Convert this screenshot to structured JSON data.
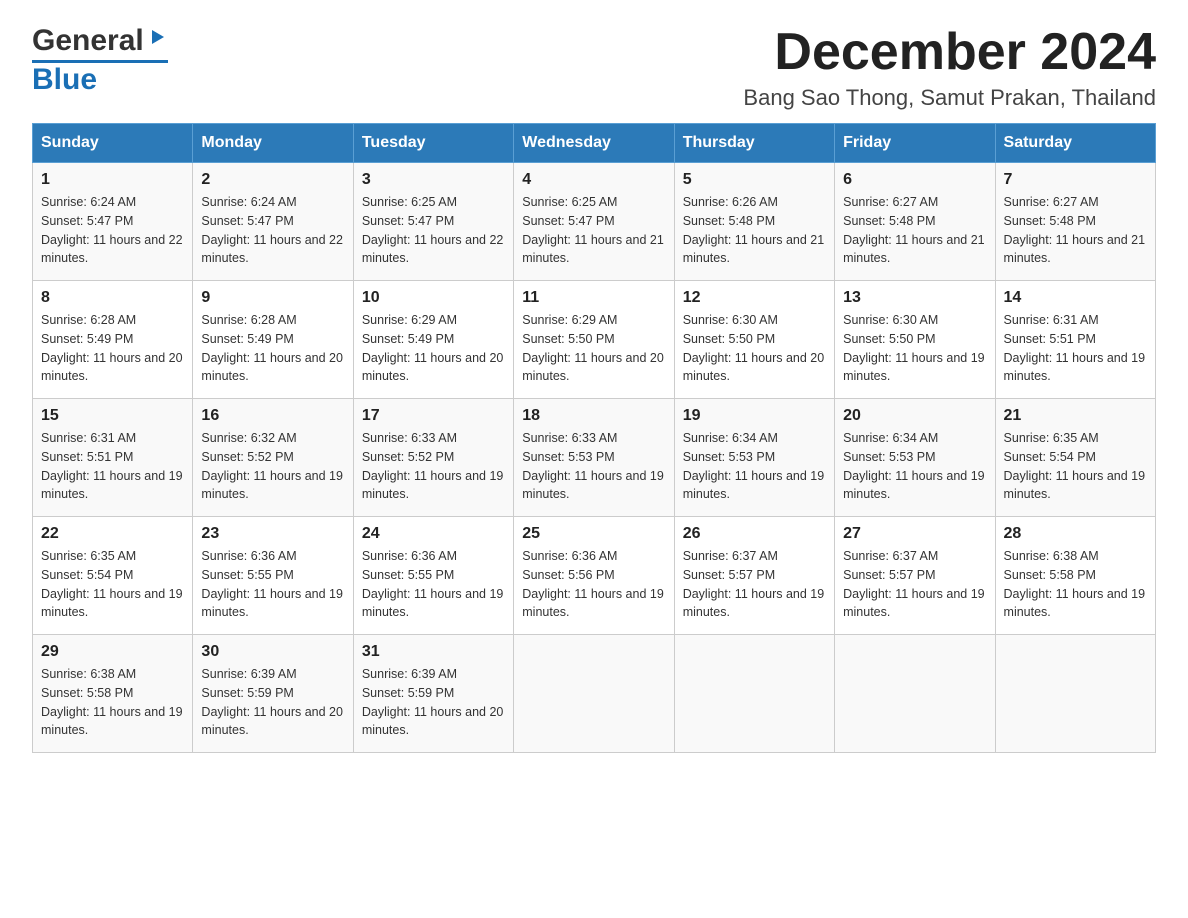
{
  "header": {
    "logo_general": "General",
    "logo_blue": "Blue",
    "month_title": "December 2024",
    "location": "Bang Sao Thong, Samut Prakan, Thailand"
  },
  "weekdays": [
    "Sunday",
    "Monday",
    "Tuesday",
    "Wednesday",
    "Thursday",
    "Friday",
    "Saturday"
  ],
  "weeks": [
    [
      {
        "day": "1",
        "sunrise": "6:24 AM",
        "sunset": "5:47 PM",
        "daylight": "11 hours and 22 minutes."
      },
      {
        "day": "2",
        "sunrise": "6:24 AM",
        "sunset": "5:47 PM",
        "daylight": "11 hours and 22 minutes."
      },
      {
        "day": "3",
        "sunrise": "6:25 AM",
        "sunset": "5:47 PM",
        "daylight": "11 hours and 22 minutes."
      },
      {
        "day": "4",
        "sunrise": "6:25 AM",
        "sunset": "5:47 PM",
        "daylight": "11 hours and 21 minutes."
      },
      {
        "day": "5",
        "sunrise": "6:26 AM",
        "sunset": "5:48 PM",
        "daylight": "11 hours and 21 minutes."
      },
      {
        "day": "6",
        "sunrise": "6:27 AM",
        "sunset": "5:48 PM",
        "daylight": "11 hours and 21 minutes."
      },
      {
        "day": "7",
        "sunrise": "6:27 AM",
        "sunset": "5:48 PM",
        "daylight": "11 hours and 21 minutes."
      }
    ],
    [
      {
        "day": "8",
        "sunrise": "6:28 AM",
        "sunset": "5:49 PM",
        "daylight": "11 hours and 20 minutes."
      },
      {
        "day": "9",
        "sunrise": "6:28 AM",
        "sunset": "5:49 PM",
        "daylight": "11 hours and 20 minutes."
      },
      {
        "day": "10",
        "sunrise": "6:29 AM",
        "sunset": "5:49 PM",
        "daylight": "11 hours and 20 minutes."
      },
      {
        "day": "11",
        "sunrise": "6:29 AM",
        "sunset": "5:50 PM",
        "daylight": "11 hours and 20 minutes."
      },
      {
        "day": "12",
        "sunrise": "6:30 AM",
        "sunset": "5:50 PM",
        "daylight": "11 hours and 20 minutes."
      },
      {
        "day": "13",
        "sunrise": "6:30 AM",
        "sunset": "5:50 PM",
        "daylight": "11 hours and 19 minutes."
      },
      {
        "day": "14",
        "sunrise": "6:31 AM",
        "sunset": "5:51 PM",
        "daylight": "11 hours and 19 minutes."
      }
    ],
    [
      {
        "day": "15",
        "sunrise": "6:31 AM",
        "sunset": "5:51 PM",
        "daylight": "11 hours and 19 minutes."
      },
      {
        "day": "16",
        "sunrise": "6:32 AM",
        "sunset": "5:52 PM",
        "daylight": "11 hours and 19 minutes."
      },
      {
        "day": "17",
        "sunrise": "6:33 AM",
        "sunset": "5:52 PM",
        "daylight": "11 hours and 19 minutes."
      },
      {
        "day": "18",
        "sunrise": "6:33 AM",
        "sunset": "5:53 PM",
        "daylight": "11 hours and 19 minutes."
      },
      {
        "day": "19",
        "sunrise": "6:34 AM",
        "sunset": "5:53 PM",
        "daylight": "11 hours and 19 minutes."
      },
      {
        "day": "20",
        "sunrise": "6:34 AM",
        "sunset": "5:53 PM",
        "daylight": "11 hours and 19 minutes."
      },
      {
        "day": "21",
        "sunrise": "6:35 AM",
        "sunset": "5:54 PM",
        "daylight": "11 hours and 19 minutes."
      }
    ],
    [
      {
        "day": "22",
        "sunrise": "6:35 AM",
        "sunset": "5:54 PM",
        "daylight": "11 hours and 19 minutes."
      },
      {
        "day": "23",
        "sunrise": "6:36 AM",
        "sunset": "5:55 PM",
        "daylight": "11 hours and 19 minutes."
      },
      {
        "day": "24",
        "sunrise": "6:36 AM",
        "sunset": "5:55 PM",
        "daylight": "11 hours and 19 minutes."
      },
      {
        "day": "25",
        "sunrise": "6:36 AM",
        "sunset": "5:56 PM",
        "daylight": "11 hours and 19 minutes."
      },
      {
        "day": "26",
        "sunrise": "6:37 AM",
        "sunset": "5:57 PM",
        "daylight": "11 hours and 19 minutes."
      },
      {
        "day": "27",
        "sunrise": "6:37 AM",
        "sunset": "5:57 PM",
        "daylight": "11 hours and 19 minutes."
      },
      {
        "day": "28",
        "sunrise": "6:38 AM",
        "sunset": "5:58 PM",
        "daylight": "11 hours and 19 minutes."
      }
    ],
    [
      {
        "day": "29",
        "sunrise": "6:38 AM",
        "sunset": "5:58 PM",
        "daylight": "11 hours and 19 minutes."
      },
      {
        "day": "30",
        "sunrise": "6:39 AM",
        "sunset": "5:59 PM",
        "daylight": "11 hours and 20 minutes."
      },
      {
        "day": "31",
        "sunrise": "6:39 AM",
        "sunset": "5:59 PM",
        "daylight": "11 hours and 20 minutes."
      },
      null,
      null,
      null,
      null
    ]
  ],
  "labels": {
    "sunrise": "Sunrise:",
    "sunset": "Sunset:",
    "daylight": "Daylight:"
  }
}
